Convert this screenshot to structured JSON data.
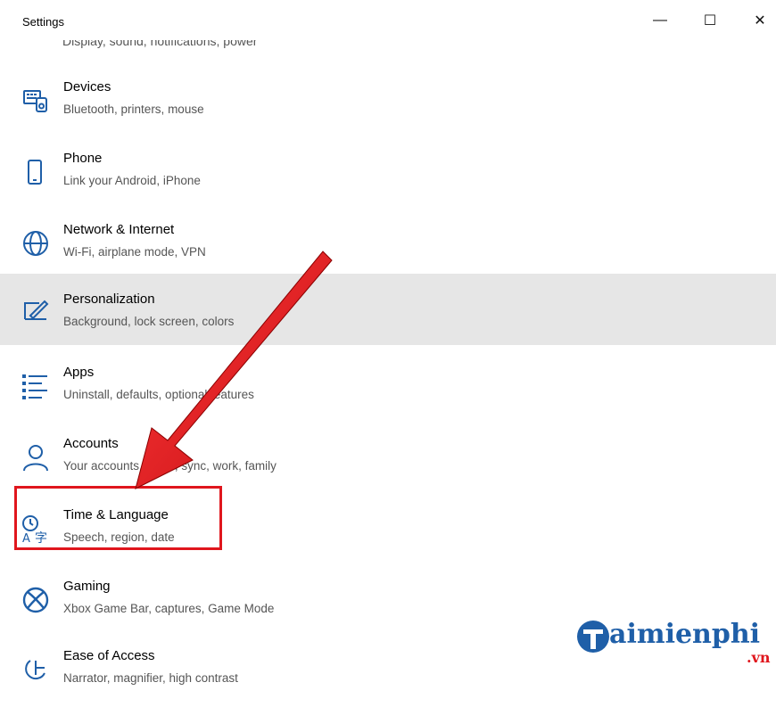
{
  "window": {
    "title": "Settings",
    "minimize": "—",
    "maximize": "☐",
    "close": "✕"
  },
  "partial_item": {
    "desc": "Display, sound, notifications, power"
  },
  "items": [
    {
      "name": "Devices",
      "desc": "Bluetooth, printers, mouse",
      "icon": "devices-icon"
    },
    {
      "name": "Phone",
      "desc": "Link your Android, iPhone",
      "icon": "phone-icon"
    },
    {
      "name": "Network & Internet",
      "desc": "Wi-Fi, airplane mode, VPN",
      "icon": "globe-icon"
    },
    {
      "name": "Personalization",
      "desc": "Background, lock screen, colors",
      "icon": "personalization-icon"
    },
    {
      "name": "Apps",
      "desc": "Uninstall, defaults, optional features",
      "icon": "apps-list-icon"
    },
    {
      "name": "Accounts",
      "desc": "Your accounts, email, sync, work, family",
      "icon": "person-icon"
    },
    {
      "name": "Time & Language",
      "desc": "Speech, region, date",
      "icon": "time-language-icon"
    },
    {
      "name": "Gaming",
      "desc": "Xbox Game Bar, captures, Game Mode",
      "icon": "xbox-icon"
    },
    {
      "name": "Ease of Access",
      "desc": "Narrator, magnifier, high contrast",
      "icon": "ease-of-access-icon"
    }
  ],
  "watermark": {
    "text": "aimienphi",
    "sub": ".vn"
  },
  "colors": {
    "accent": "#e0161d",
    "icon_blue": "#1f5fa8",
    "hover": "#e6e6e6"
  }
}
